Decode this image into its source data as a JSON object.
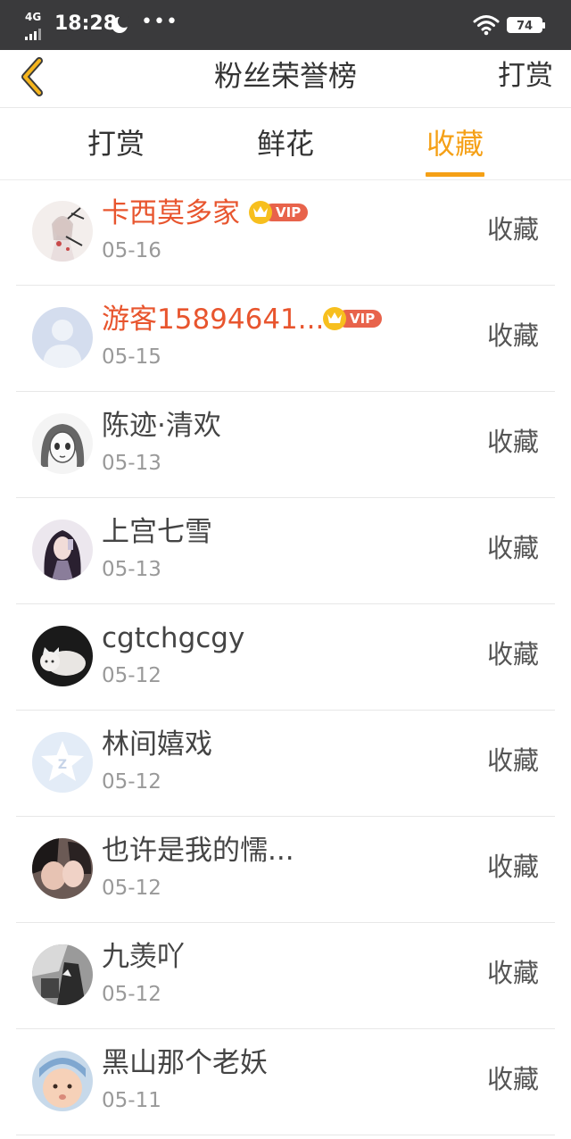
{
  "status_bar": {
    "network": "4G",
    "time": "18:28",
    "battery": "74"
  },
  "header": {
    "title": "粉丝荣誉榜",
    "right_action": "打赏"
  },
  "tabs": [
    {
      "label": "打赏",
      "active": false
    },
    {
      "label": "鲜花",
      "active": false
    },
    {
      "label": "收藏",
      "active": true
    }
  ],
  "vip_label": "VIP",
  "colors": {
    "accent": "#f5a016",
    "vip_name": "#e8552e",
    "vip_tag": "#e8634b",
    "status_bar": "#3a3a3c"
  },
  "fans": [
    {
      "name": "卡西莫多家",
      "date": "05-16",
      "action": "收藏",
      "vip": true,
      "avatar": "anime-girl-avatar"
    },
    {
      "name": "游客15894641...",
      "date": "05-15",
      "action": "收藏",
      "vip": true,
      "avatar": "default-user-avatar"
    },
    {
      "name": "陈迹·清欢",
      "date": "05-13",
      "action": "收藏",
      "vip": false,
      "avatar": "sketch-girl-avatar"
    },
    {
      "name": "上宫七雪",
      "date": "05-13",
      "action": "收藏",
      "vip": false,
      "avatar": "dark-hair-girl-avatar"
    },
    {
      "name": "cgtchgcgy",
      "date": "05-12",
      "action": "收藏",
      "vip": false,
      "avatar": "cat-photo-avatar"
    },
    {
      "name": "林间嬉戏",
      "date": "05-12",
      "action": "收藏",
      "vip": false,
      "avatar": "qq-star-avatar"
    },
    {
      "name": "也许是我的懦...",
      "date": "05-12",
      "action": "收藏",
      "vip": false,
      "avatar": "couple-photo-avatar"
    },
    {
      "name": "九羡吖",
      "date": "05-12",
      "action": "收藏",
      "vip": false,
      "avatar": "bw-photo-avatar"
    },
    {
      "name": "黑山那个老妖",
      "date": "05-11",
      "action": "收藏",
      "vip": false,
      "avatar": "baby-photo-avatar"
    }
  ]
}
